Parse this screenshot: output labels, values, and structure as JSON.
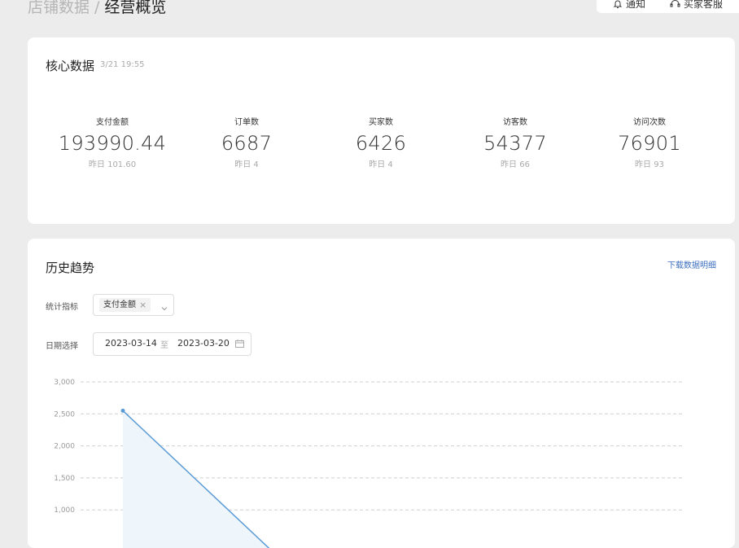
{
  "breadcrumb": {
    "parent": "店铺数据",
    "separator": "/",
    "current": "经营概览"
  },
  "top_actions": {
    "notice_label": "通知",
    "service_label": "买家客服"
  },
  "core": {
    "title": "核心数据",
    "time": "3/21 19:55",
    "metrics": [
      {
        "label": "支付金额",
        "value": "193990.44",
        "yesterday": "昨日 101.60"
      },
      {
        "label": "订单数",
        "value": "6687",
        "yesterday": "昨日 4"
      },
      {
        "label": "买家数",
        "value": "6426",
        "yesterday": "昨日 4"
      },
      {
        "label": "访客数",
        "value": "54377",
        "yesterday": "昨日 66"
      },
      {
        "label": "访问次数",
        "value": "76901",
        "yesterday": "昨日 93"
      }
    ]
  },
  "trend": {
    "title": "历史趋势",
    "download_label": "下载数据明细",
    "indicator_label": "统计指标",
    "indicator_tag": "支付金额",
    "date_label": "日期选择",
    "date_start": "2023-03-14",
    "date_separator": "至",
    "date_end": "2023-03-20"
  },
  "colors": {
    "line": "#5b9bd5",
    "area": "#eef5fb",
    "link": "#3d6fbf"
  },
  "chart_data": {
    "type": "area",
    "y_ticks": [
      "3,000",
      "2,500",
      "2,000",
      "1,500",
      "1,000"
    ],
    "ylim": [
      0,
      3000
    ],
    "grid": true,
    "series": [
      {
        "points": [
          {
            "x": 0,
            "y": 2550
          },
          {
            "x": 1,
            "y": 0
          }
        ]
      }
    ]
  }
}
